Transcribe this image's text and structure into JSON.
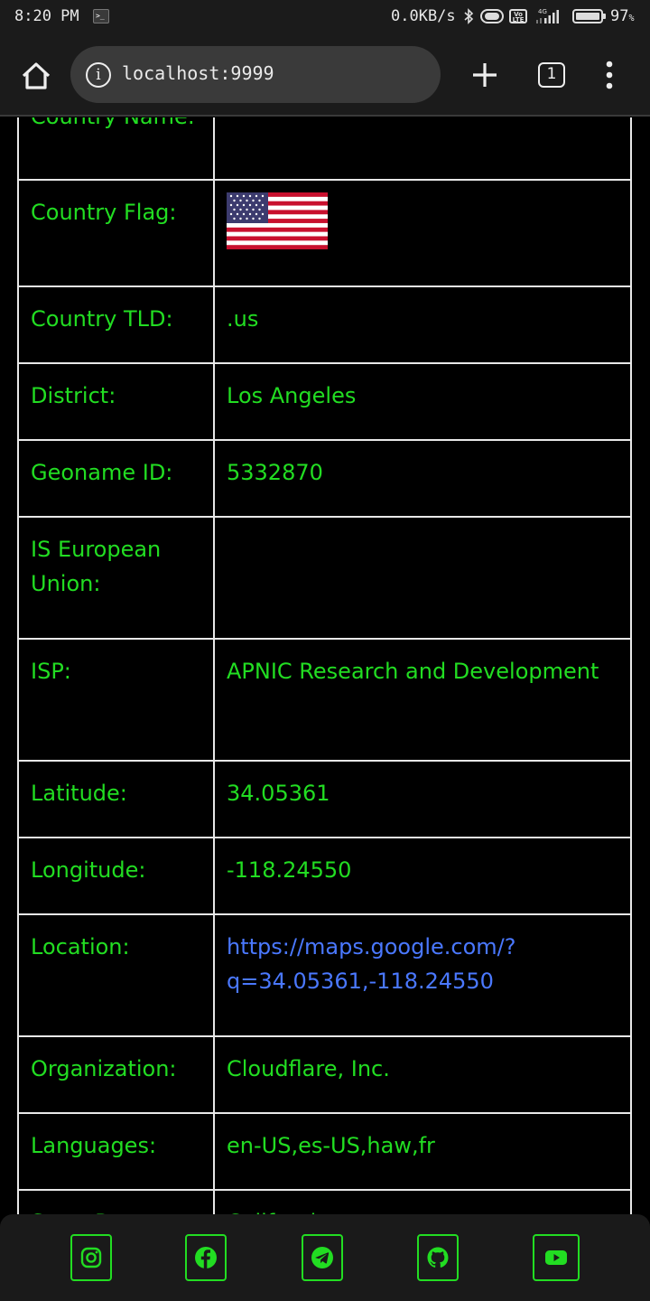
{
  "status_bar": {
    "time": "8:20 PM",
    "speed": "0.0KB/s",
    "volte": "Vo LTE",
    "network": "4G",
    "battery": "97",
    "battery_unit": "%"
  },
  "browser": {
    "url": "localhost:9999",
    "tab_count": "1"
  },
  "table": {
    "rows": [
      {
        "label": "Country Name:",
        "value": ""
      },
      {
        "label": "Country Flag:",
        "value": ""
      },
      {
        "label": "Country TLD:",
        "value": ".us"
      },
      {
        "label": "District:",
        "value": "Los Angeles"
      },
      {
        "label": "Geoname ID:",
        "value": "5332870"
      },
      {
        "label": "IS European Union:",
        "value": ""
      },
      {
        "label": "ISP:",
        "value": "APNIC Research and Development"
      },
      {
        "label": "Latitude:",
        "value": "34.05361"
      },
      {
        "label": "Longitude:",
        "value": "-118.24550"
      },
      {
        "label": "Location:",
        "value": "https://maps.google.com/?q=34.05361,-118.24550"
      },
      {
        "label": "Organization:",
        "value": "Cloudflare, Inc."
      },
      {
        "label": "Languages:",
        "value": "en-US,es-US,haw,fr"
      },
      {
        "label": "State Prov:",
        "value": "California"
      }
    ]
  },
  "footer": {
    "links": [
      "instagram-icon",
      "facebook-icon",
      "telegram-icon",
      "github-icon",
      "youtube-icon"
    ]
  },
  "colors": {
    "text_green": "#22dd22",
    "link_blue": "#4a78ff",
    "background": "#000000"
  }
}
